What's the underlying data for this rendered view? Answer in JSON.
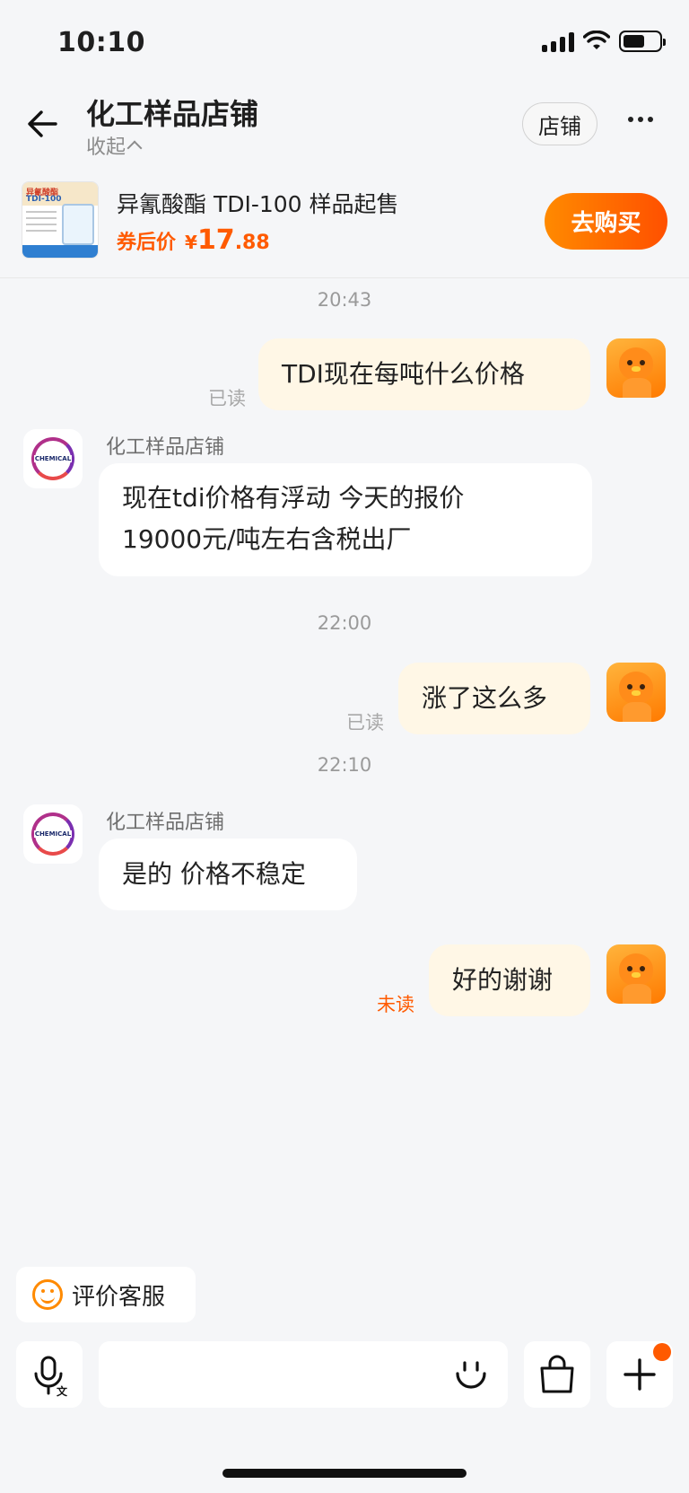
{
  "status_bar": {
    "time": "10:10"
  },
  "header": {
    "title": "化工样品店铺",
    "collapse_label": "收起",
    "store_button": "店铺"
  },
  "product": {
    "name": "异氰酸酯 TDI-100 样品起售",
    "price_label": "券后价",
    "currency": "¥",
    "price_int": "17",
    "price_dec": ".88",
    "buy_button": "去购买",
    "thumb_text_1": "异氰酸酯",
    "thumb_text_2": "TDI-100"
  },
  "chat": {
    "timestamps": [
      "20:43",
      "22:00",
      "22:10"
    ],
    "messages": [
      {
        "from": "me",
        "text": "TDI现在每吨什么价格",
        "status": "已读"
      },
      {
        "from": "shop",
        "sender": "化工样品店铺",
        "lines": [
          "现在tdi价格有浮动  今天的报价",
          "19000元/吨左右含税出厂"
        ]
      },
      {
        "from": "me",
        "text": "涨了这么多",
        "status": "已读"
      },
      {
        "from": "shop",
        "sender": "化工样品店铺",
        "text": "是的 价格不稳定"
      },
      {
        "from": "me",
        "text": "好的谢谢",
        "status": "未读"
      }
    ],
    "shop_avatar_text": "CHEMICAL"
  },
  "bottom": {
    "rate_label": "评价客服",
    "input_placeholder": ""
  },
  "colors": {
    "accent": "#ff5a00",
    "my_bubble": "#fff7e6",
    "background": "#f5f6f8"
  }
}
